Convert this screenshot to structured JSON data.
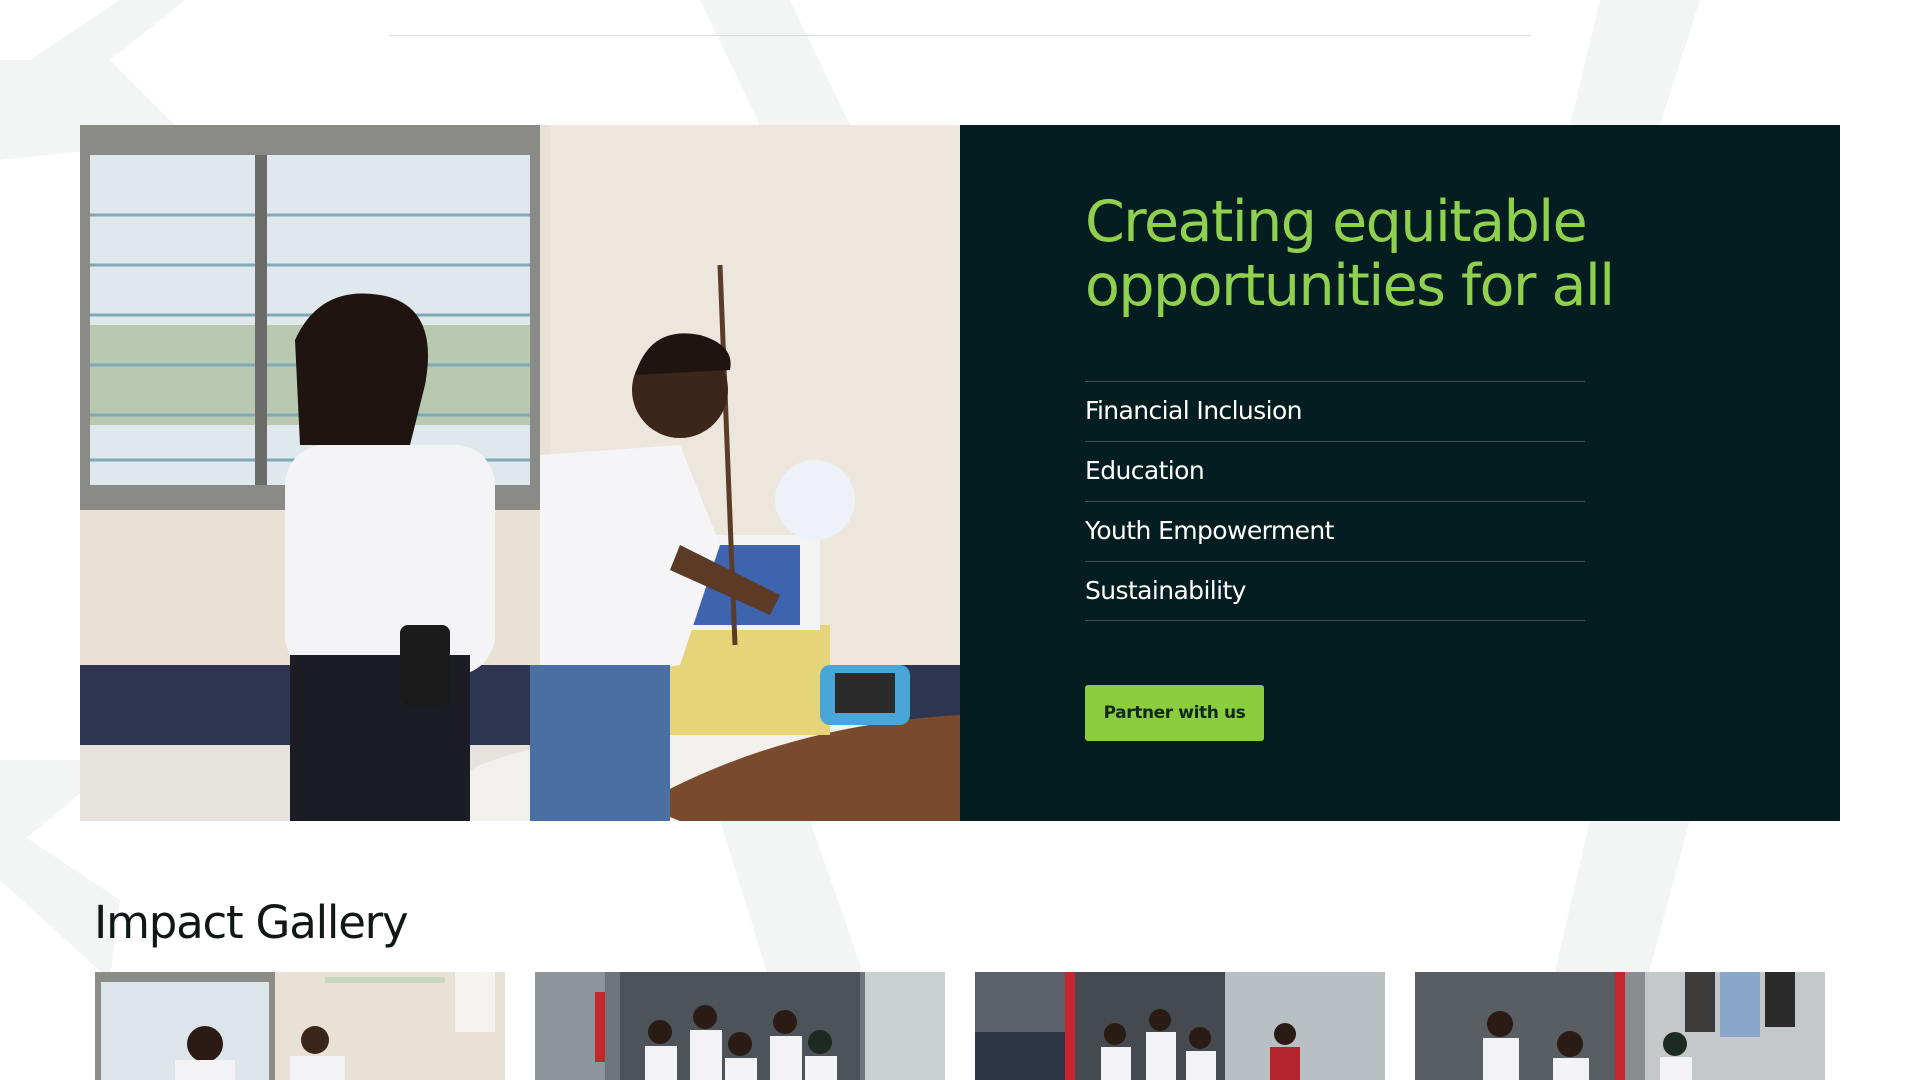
{
  "hero": {
    "title_line1": "Creating equitable",
    "title_line2": "opportunities for all",
    "focus_areas": [
      "Financial Inclusion",
      "Education",
      "Youth Empowerment",
      "Sustainability"
    ],
    "cta_label": "Partner with us",
    "photo_description_icon": "photo-hospital-donation"
  },
  "gallery": {
    "title": "Impact Gallery",
    "items": [
      {
        "icon": "photo-hospital-visit"
      },
      {
        "icon": "photo-team-in-container"
      },
      {
        "icon": "photo-team-market"
      },
      {
        "icon": "photo-team-shop"
      }
    ]
  },
  "colors": {
    "panel_bg": "#031d20",
    "accent_green": "#8fd14f",
    "button_green": "#8ccc3f",
    "page_bg": "#ffffff"
  }
}
